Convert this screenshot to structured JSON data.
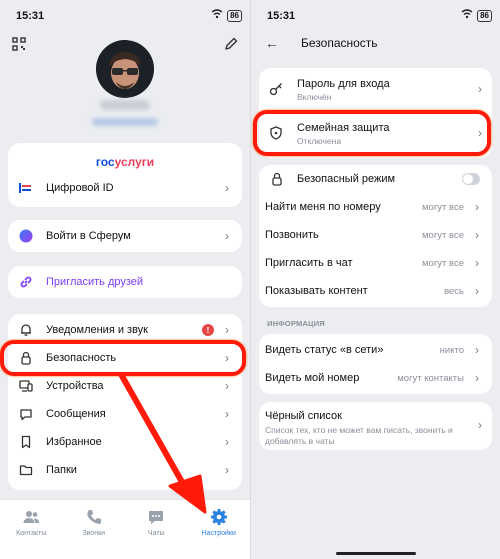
{
  "status_left": {
    "time": "15:31",
    "battery": "86"
  },
  "status_right": {
    "time": "15:31",
    "battery": "86"
  },
  "profile": {
    "name_blurred": "",
    "link_blurred": ""
  },
  "gosuslugi": {
    "part1": "гос",
    "part2": "услуги"
  },
  "settings": {
    "digital_id": "Цифровой ID",
    "sferum": "Войти в Сферум",
    "invite": "Пригласить друзей",
    "notifications": "Уведомления и звук",
    "notifications_badge": "!",
    "security": "Безопасность",
    "devices": "Устройства",
    "messages": "Сообщения",
    "favorites": "Избранное",
    "folders": "Папки"
  },
  "tabs": [
    {
      "label": "Контакты"
    },
    {
      "label": "Звонки"
    },
    {
      "label": "Чаты"
    },
    {
      "label": "Настройки"
    }
  ],
  "security_screen": {
    "title": "Безопасность",
    "password": {
      "label": "Пароль для входа",
      "sub": "Включён"
    },
    "family": {
      "label": "Семейная защита",
      "sub": "Отключена"
    },
    "safe_mode": {
      "label": "Безопасный режим",
      "enabled": false
    },
    "find_me": {
      "label": "Найти меня по номеру",
      "value": "могут все"
    },
    "call": {
      "label": "Позвонить",
      "value": "могут все"
    },
    "invite_chat": {
      "label": "Пригласить в чат",
      "value": "могут все"
    },
    "show_content": {
      "label": "Показывать контент",
      "value": "весь"
    },
    "info_section": "ИНФОРМАЦИЯ",
    "online_status": {
      "label": "Видеть статус «в сети»",
      "value": "никто"
    },
    "my_number": {
      "label": "Видеть мой номер",
      "value": "могут контакты"
    },
    "blacklist": {
      "label": "Чёрный список",
      "sub": "Список тех, кто не может вам писать, звонить и добавлять в чаты"
    }
  },
  "colors": {
    "accent": "#2d81e0",
    "highlight": "#ff1a0a",
    "gos_blue": "#0d4cd3",
    "gos_red": "#ee3f58"
  }
}
